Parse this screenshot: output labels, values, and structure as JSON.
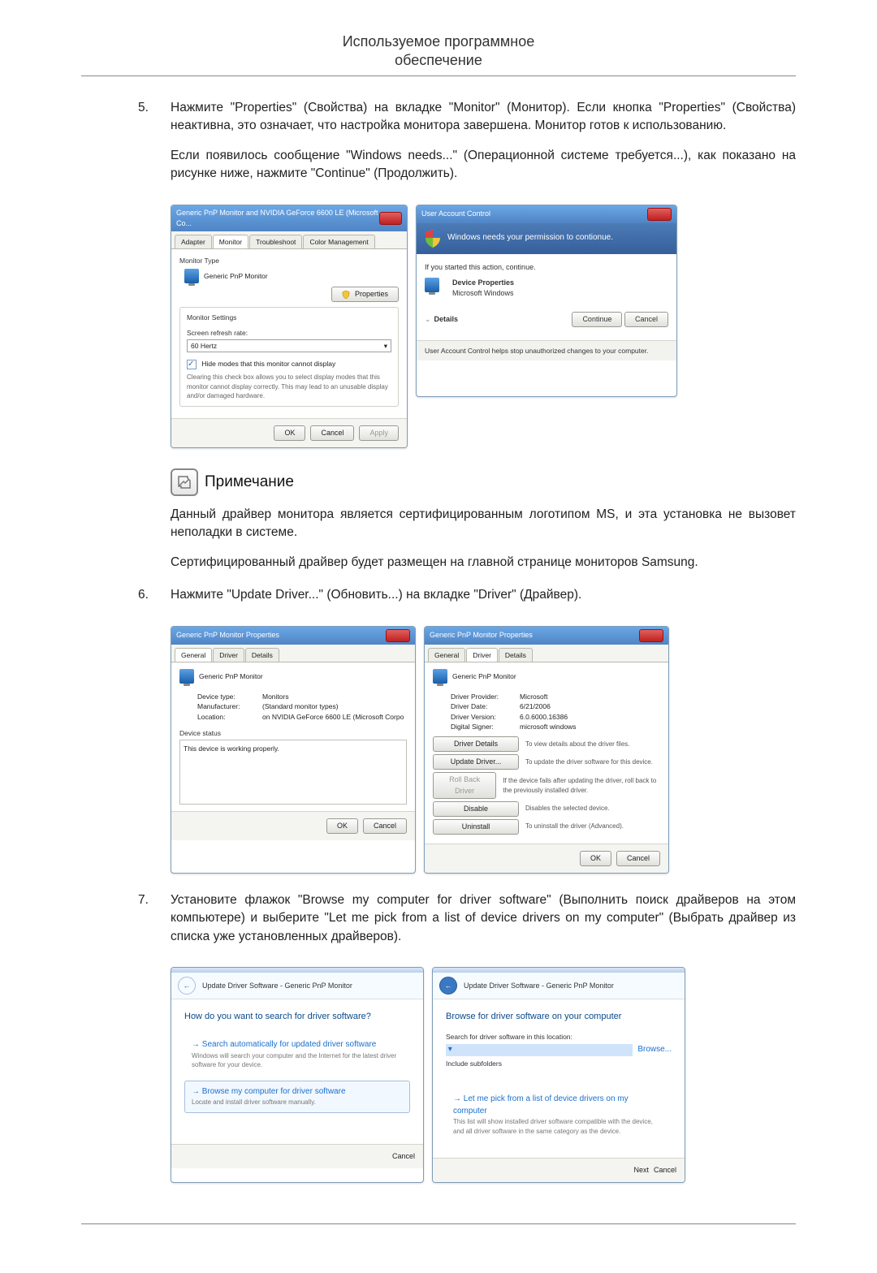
{
  "header": {
    "line1": "Используемое программное",
    "line2": "обеспечение"
  },
  "items": {
    "five": {
      "num": "5.",
      "p1": "Нажмите \"Properties\" (Свойства) на вкладке \"Monitor\" (Монитор). Если кнопка \"Properties\" (Свойства) неактивна, это означает, что настройка монитора завершена. Монитор готов к использованию.",
      "p2": "Если появилось сообщение \"Windows needs...\" (Операционной системе требуется...), как показано на рисунке ниже, нажмите \"Continue\" (Продолжить)."
    },
    "six": {
      "num": "6.",
      "p1": "Нажмите \"Update Driver...\" (Обновить...) на вкладке \"Driver\" (Драйвер)."
    },
    "seven": {
      "num": "7.",
      "p1": "Установите флажок \"Browse my computer for driver software\" (Выполнить поиск драйверов на этом компьютере) и выберите \"Let me pick from a list of device drivers on my computer\" (Выбрать драйвер из списка уже установленных драйверов)."
    }
  },
  "note": {
    "title": "Примечание",
    "p1": "Данный драйвер монитора является сертифицированным логотипом MS, и эта установка не вызовет неполадки в системе.",
    "p2": "Сертифицированный драйвер будет размещен на главной странице мониторов Samsung."
  },
  "fig1": {
    "left": {
      "title": "Generic PnP Monitor and NVIDIA GeForce 6600 LE (Microsoft Co...",
      "tabs": {
        "adapter": "Adapter",
        "monitor": "Monitor",
        "troubleshoot": "Troubleshoot",
        "color": "Color Management"
      },
      "monitor_type_label": "Monitor Type",
      "monitor_type_value": "Generic PnP Monitor",
      "properties_btn": "Properties",
      "monitor_settings_label": "Monitor Settings",
      "refresh_label": "Screen refresh rate:",
      "refresh_value": "60 Hertz",
      "hide_label": "Hide modes that this monitor cannot display",
      "hide_desc": "Clearing this check box allows you to select display modes that this monitor cannot display correctly. This may lead to an unusable display and/or damaged hardware.",
      "ok": "OK",
      "cancel": "Cancel",
      "apply": "Apply"
    },
    "right": {
      "title": "User Account Control",
      "headline": "Windows needs your permission to contionue.",
      "if_started": "If you started this action, continue.",
      "dev_name": "Device Properties",
      "dev_pub": "Microsoft Windows",
      "details": "Details",
      "continue": "Continue",
      "cancel": "Cancel",
      "footer": "User Account Control helps stop unauthorized changes to your computer."
    }
  },
  "fig2": {
    "left": {
      "title": "Generic PnP Monitor Properties",
      "tabs": {
        "general": "General",
        "driver": "Driver",
        "details": "Details"
      },
      "name": "Generic PnP Monitor",
      "dev_type_l": "Device type:",
      "dev_type_v": "Monitors",
      "manu_l": "Manufacturer:",
      "manu_v": "(Standard monitor types)",
      "loc_l": "Location:",
      "loc_v": "on NVIDIA GeForce 6600 LE (Microsoft Corpo",
      "status_l": "Device status",
      "status_v": "This device is working properly.",
      "ok": "OK",
      "cancel": "Cancel"
    },
    "right": {
      "title": "Generic PnP Monitor Properties",
      "tabs": {
        "general": "General",
        "driver": "Driver",
        "details": "Details"
      },
      "name": "Generic PnP Monitor",
      "provider_l": "Driver Provider:",
      "provider_v": "Microsoft",
      "date_l": "Driver Date:",
      "date_v": "6/21/2006",
      "ver_l": "Driver Version:",
      "ver_v": "6.0.6000.16386",
      "signer_l": "Digital Signer:",
      "signer_v": "microsoft windows",
      "b1": "Driver Details",
      "b1d": "To view details about the driver files.",
      "b2": "Update Driver...",
      "b2d": "To update the driver software for this device.",
      "b3": "Roll Back Driver",
      "b3d": "If the device fails after updating the driver, roll back to the previously installed driver.",
      "b4": "Disable",
      "b4d": "Disables the selected device.",
      "b5": "Uninstall",
      "b5d": "To uninstall the driver (Advanced).",
      "ok": "OK",
      "cancel": "Cancel"
    }
  },
  "fig3": {
    "left": {
      "crumb": "Update Driver Software - Generic PnP Monitor",
      "headline": "How do you want to search for driver software?",
      "opt1_t": "Search automatically for updated driver software",
      "opt1_s": "Windows will search your computer and the Internet for the latest driver software for your device.",
      "opt2_t": "Browse my computer for driver software",
      "opt2_s": "Locate and install driver software manually.",
      "cancel": "Cancel"
    },
    "right": {
      "crumb": "Update Driver Software - Generic PnP Monitor",
      "headline": "Browse for driver software on your computer",
      "search_l": "Search for driver software in this location:",
      "browse": "Browse...",
      "include": "Include subfolders",
      "opt_t": "Let me pick from a list of device drivers on my computer",
      "opt_s": "This list will show installed driver software compatible with the device, and all driver software in the same category as the device.",
      "next": "Next",
      "cancel": "Cancel"
    }
  }
}
